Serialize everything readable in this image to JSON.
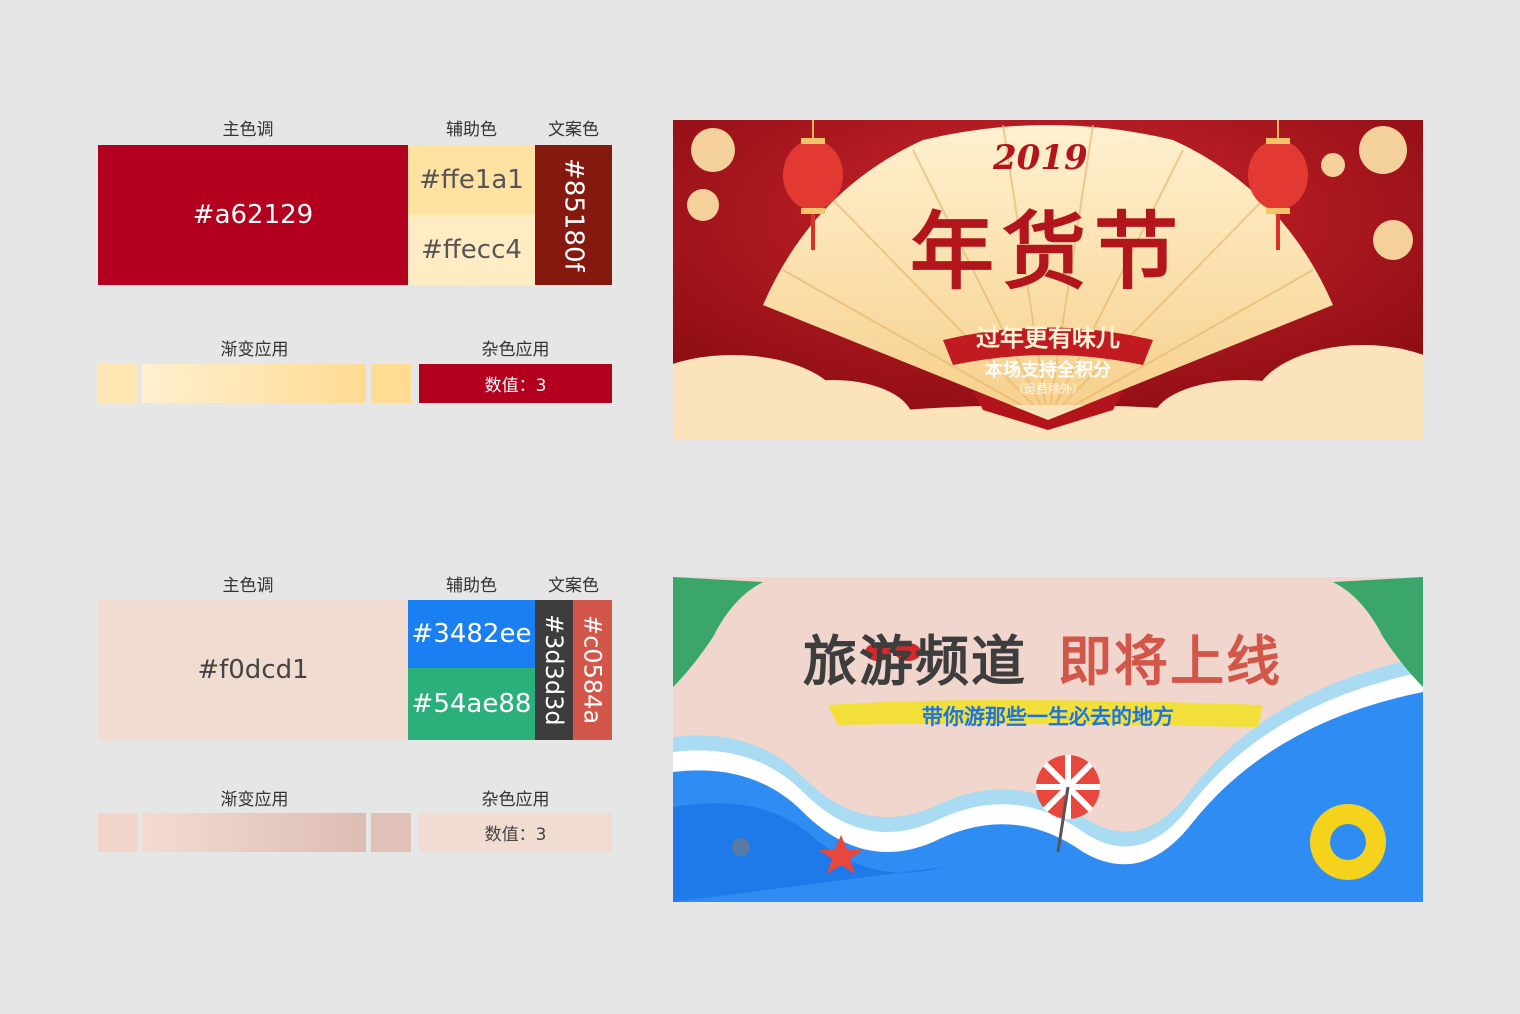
{
  "palette1": {
    "main_label": "主色调",
    "aux_label": "辅助色",
    "text_label": "文案色",
    "main_hex": "#a62129",
    "aux1_hex": "#ffe1a1",
    "aux2_hex": "#ffecc4",
    "text_hex": "#85180f",
    "gradient_label": "渐变应用",
    "noise_label": "杂色应用",
    "noise_value": "数值：3",
    "colors": {
      "main": "#b3001e",
      "aux1": "#ffe1a1",
      "aux2": "#ffecc4",
      "text": "#85180f"
    }
  },
  "palette2": {
    "main_label": "主色调",
    "aux_label": "辅助色",
    "text_label": "文案色",
    "main_hex": "#f0dcd1",
    "aux1_hex": "#3482ee",
    "aux2_hex": "#54ae88",
    "text1_hex": "#3d3d3d",
    "text2_hex": "#c0584a",
    "gradient_label": "渐变应用",
    "noise_label": "杂色应用",
    "noise_value": "数值：3",
    "colors": {
      "main": "#f0dcd1",
      "aux1": "#1a7ff0",
      "aux2": "#2bb07b",
      "text1": "#3d3d3d",
      "text2": "#d2564a"
    }
  },
  "banner1": {
    "year": "2019",
    "title": "年货节",
    "subtitle": "过年更有味儿",
    "line1": "本场支持全积分",
    "line2": "（运费除外）"
  },
  "banner2": {
    "title_part1": "旅游频道",
    "title_part2": "即将上线",
    "subtitle": "带你游那些一生必去的地方"
  }
}
